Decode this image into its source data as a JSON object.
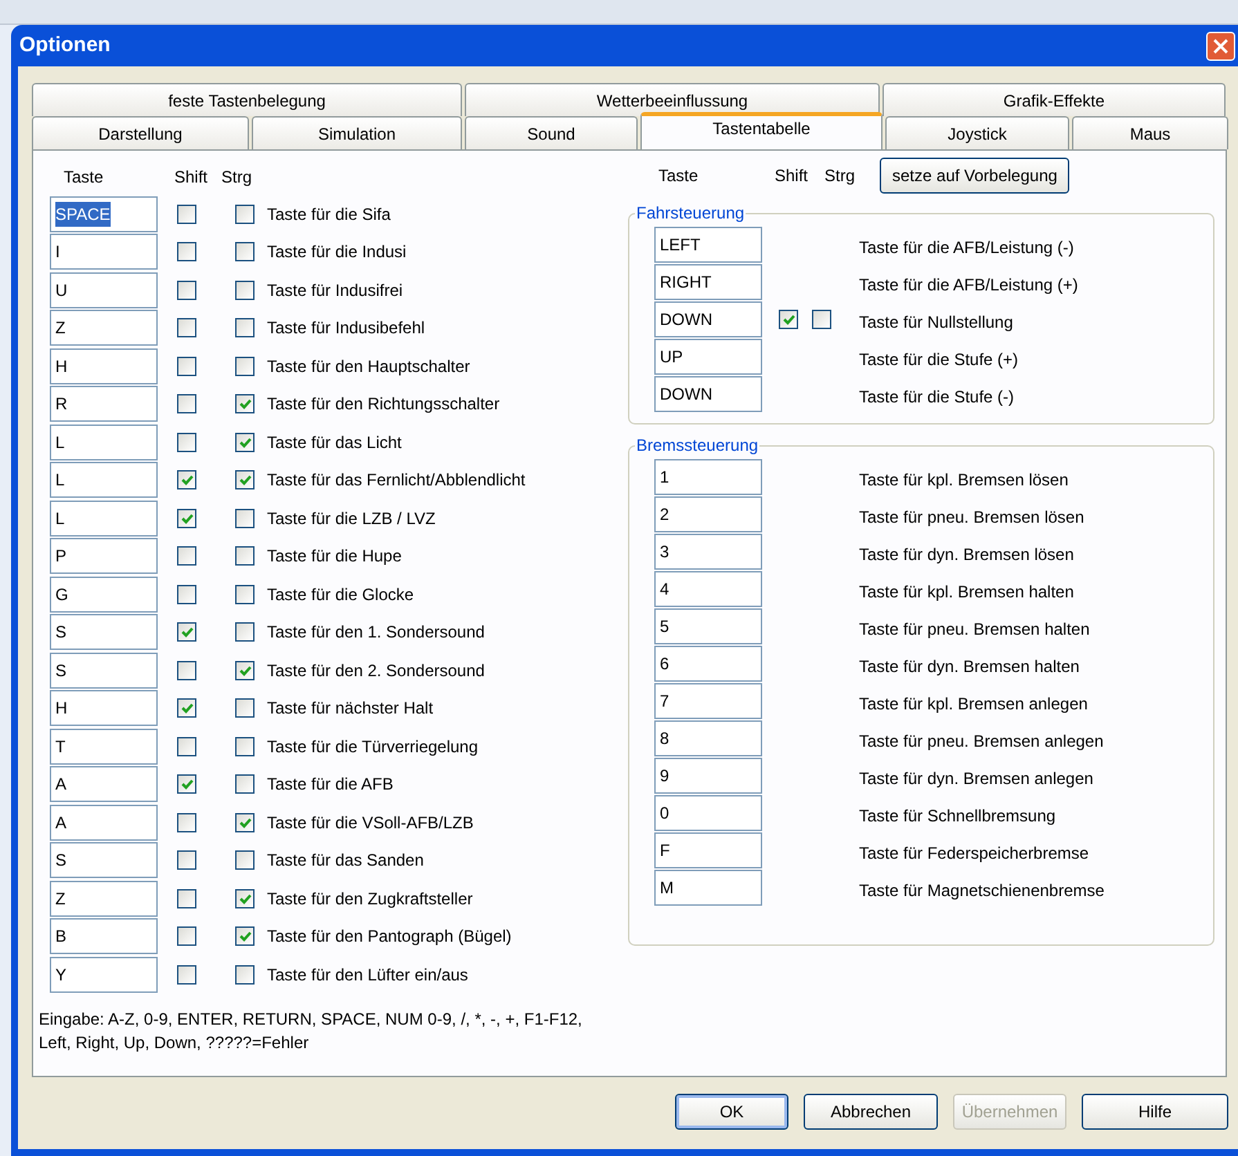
{
  "window": {
    "title": "Optionen"
  },
  "tabs": [
    [
      {
        "label": "feste Tastenbelegung",
        "selected": false
      },
      {
        "label": "Wetterbeeinflussung",
        "selected": false
      },
      {
        "label": "Grafik-Effekte",
        "selected": false
      }
    ],
    [
      {
        "label": "Darstellung",
        "selected": false
      },
      {
        "label": "Simulation",
        "selected": false
      },
      {
        "label": "Sound",
        "selected": false
      },
      {
        "label": "Tastentabelle",
        "selected": true
      },
      {
        "label": "Joystick",
        "selected": false
      },
      {
        "label": "Maus",
        "selected": false
      }
    ]
  ],
  "left": {
    "headers": [
      "Taste",
      "Shift",
      "Strg"
    ],
    "rows": [
      {
        "key": "SPACE",
        "shift": false,
        "strg": false,
        "label": "Taste für die Sifa",
        "selected": true
      },
      {
        "key": "I",
        "shift": false,
        "strg": false,
        "label": "Taste für die Indusi",
        "selected": false
      },
      {
        "key": "U",
        "shift": false,
        "strg": false,
        "label": "Taste für Indusifrei",
        "selected": false
      },
      {
        "key": "Z",
        "shift": false,
        "strg": false,
        "label": "Taste für Indusibefehl",
        "selected": false
      },
      {
        "key": "H",
        "shift": false,
        "strg": false,
        "label": "Taste für den Hauptschalter",
        "selected": false
      },
      {
        "key": "R",
        "shift": false,
        "strg": true,
        "label": "Taste für den Richtungsschalter",
        "selected": false
      },
      {
        "key": "L",
        "shift": false,
        "strg": true,
        "label": "Taste für das Licht",
        "selected": false
      },
      {
        "key": "L",
        "shift": true,
        "strg": true,
        "label": "Taste für das Fernlicht/Abblendlicht",
        "selected": false
      },
      {
        "key": "L",
        "shift": true,
        "strg": false,
        "label": "Taste für die LZB / LVZ",
        "selected": false
      },
      {
        "key": "P",
        "shift": false,
        "strg": false,
        "label": "Taste für die Hupe",
        "selected": false
      },
      {
        "key": "G",
        "shift": false,
        "strg": false,
        "label": "Taste für die Glocke",
        "selected": false
      },
      {
        "key": "S",
        "shift": true,
        "strg": false,
        "label": "Taste für den 1. Sondersound",
        "selected": false
      },
      {
        "key": "S",
        "shift": false,
        "strg": true,
        "label": "Taste für den 2. Sondersound",
        "selected": false
      },
      {
        "key": "H",
        "shift": true,
        "strg": false,
        "label": "Taste für nächster Halt",
        "selected": false
      },
      {
        "key": "T",
        "shift": false,
        "strg": false,
        "label": "Taste für die Türverriegelung",
        "selected": false
      },
      {
        "key": "A",
        "shift": true,
        "strg": false,
        "label": "Taste für die AFB",
        "selected": false
      },
      {
        "key": "A",
        "shift": false,
        "strg": true,
        "label": "Taste für die VSoll-AFB/LZB",
        "selected": false
      },
      {
        "key": "S",
        "shift": false,
        "strg": false,
        "label": "Taste für das Sanden",
        "selected": false
      },
      {
        "key": "Z",
        "shift": false,
        "strg": true,
        "label": "Taste für den Zugkraftsteller",
        "selected": false
      },
      {
        "key": "B",
        "shift": false,
        "strg": true,
        "label": "Taste für den Pantograph (Bügel)",
        "selected": false
      },
      {
        "key": "Y",
        "shift": false,
        "strg": false,
        "label": "Taste für den Lüfter ein/aus",
        "selected": false
      }
    ],
    "hint": "Eingabe: A-Z, 0-9, ENTER, RETURN, SPACE, NUM 0-9, /, *, -, +, F1-F12, Left, Right, Up, Down, ?????=Fehler"
  },
  "right": {
    "headers": [
      "Taste",
      "Shift",
      "Strg"
    ],
    "reset_button": "setze auf Vorbelegung",
    "groups": [
      {
        "title": "Fahrsteuerung",
        "rows": [
          {
            "kind": "plain",
            "key": "LEFT",
            "label": "Taste für die AFB/Leistung (-)"
          },
          {
            "kind": "plain",
            "key": "RIGHT",
            "label": "Taste für die AFB/Leistung (+)"
          },
          {
            "kind": "modifiers",
            "key": "DOWN",
            "shift": true,
            "strg": false,
            "label": "Taste für Nullstellung"
          },
          {
            "kind": "plain",
            "key": "UP",
            "label": "Taste für die Stufe (+)"
          },
          {
            "kind": "plain",
            "key": "DOWN",
            "label": "Taste für die Stufe (-)"
          }
        ]
      },
      {
        "title": "Bremssteuerung",
        "rows": [
          {
            "kind": "plain",
            "key": "1",
            "label": "Taste für kpl. Bremsen lösen"
          },
          {
            "kind": "plain",
            "key": "2",
            "label": "Taste für pneu. Bremsen lösen"
          },
          {
            "kind": "plain",
            "key": "3",
            "label": "Taste für dyn. Bremsen lösen"
          },
          {
            "kind": "plain",
            "key": "4",
            "label": "Taste für kpl. Bremsen halten"
          },
          {
            "kind": "plain",
            "key": "5",
            "label": "Taste für pneu. Bremsen halten"
          },
          {
            "kind": "plain",
            "key": "6",
            "label": "Taste für dyn. Bremsen halten"
          },
          {
            "kind": "plain",
            "key": "7",
            "label": "Taste für kpl. Bremsen anlegen"
          },
          {
            "kind": "plain",
            "key": "8",
            "label": "Taste für pneu. Bremsen anlegen"
          },
          {
            "kind": "plain",
            "key": "9",
            "label": "Taste für dyn. Bremsen anlegen"
          },
          {
            "kind": "plain",
            "key": "0",
            "label": "Taste für Schnellbremsung"
          },
          {
            "kind": "plain",
            "key": "F",
            "label": "Taste für Federspeicherbremse"
          },
          {
            "kind": "plain",
            "key": "M",
            "label": "Taste für Magnetschienenbremse"
          }
        ]
      }
    ]
  },
  "buttons": [
    {
      "label": "OK",
      "disabled": false,
      "default": true
    },
    {
      "label": "Abbrechen",
      "disabled": false,
      "default": false
    },
    {
      "label": "Übernehmen",
      "disabled": true,
      "default": false
    },
    {
      "label": "Hilfe",
      "disabled": false,
      "default": false
    }
  ]
}
